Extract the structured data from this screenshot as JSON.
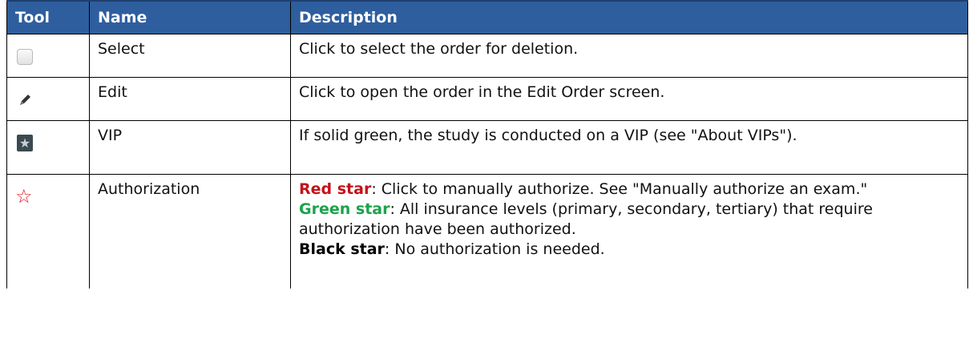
{
  "headers": {
    "tool": "Tool",
    "name": "Name",
    "description": "Description"
  },
  "rows": [
    {
      "icon": "checkbox-icon",
      "name": "Select",
      "description": "Click to select the order for deletion."
    },
    {
      "icon": "pencil-icon",
      "name": "Edit",
      "description": "Click to open the order in the Edit Order screen."
    },
    {
      "icon": "vip-star-icon",
      "name": "VIP",
      "description": "If solid green, the study is conducted on a VIP (see \"About VIPs\")."
    },
    {
      "icon": "red-star-outline-icon",
      "name": "Authorization",
      "red_label": "Red star",
      "red_text": ": Click to manually authorize. See \"Manually authorize an exam.\"",
      "green_label": "Green star",
      "green_text": ": All insurance levels (primary, secondary, tertiary) that require authorization have been authorized.",
      "black_label": "Black star",
      "black_text": ": No authorization is needed."
    }
  ],
  "colors": {
    "header_bg": "#2e5e9e",
    "red": "#c4121b",
    "green": "#1aa34a"
  }
}
